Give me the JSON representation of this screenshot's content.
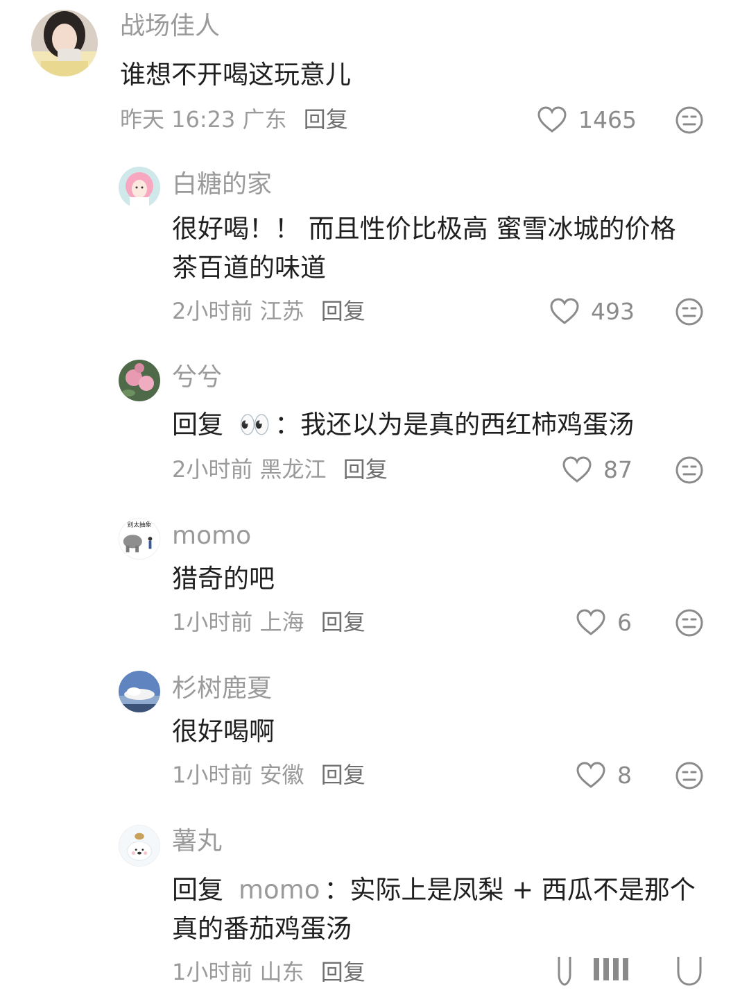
{
  "comments": [
    {
      "username": "战场佳人",
      "text": "谁想不开喝这玩意儿",
      "time": "昨天 16:23",
      "location": "广东",
      "reply_label": "回复",
      "likes": "1465"
    },
    {
      "username": "白糖的家",
      "text": "很好喝！！ 而且性价比极高 蜜雪冰城的价格 茶百道的味道",
      "time": "2小时前",
      "location": "江苏",
      "reply_label": "回复",
      "likes": "493"
    },
    {
      "username": "兮兮",
      "reply_prefix": "回复",
      "reply_target": "👀",
      "text": "：我还以为是真的西红柿鸡蛋汤",
      "time": "2小时前",
      "location": "黑龙江",
      "reply_label": "回复",
      "likes": "87"
    },
    {
      "username": "momo",
      "avatar_text": "别太抽象",
      "text": "猎奇的吧",
      "time": "1小时前",
      "location": "上海",
      "reply_label": "回复",
      "likes": "6"
    },
    {
      "username": "杉树鹿夏",
      "text": "很好喝啊",
      "time": "1小时前",
      "location": "安徽",
      "reply_label": "回复",
      "likes": "8"
    },
    {
      "username": "薯丸",
      "reply_prefix": "回复",
      "reply_target": "momo",
      "text": "：实际上是凤梨 + 西瓜不是那个真的番茄鸡蛋汤",
      "time": "1小时前",
      "location": "山东",
      "reply_label": "回复"
    }
  ],
  "colors": {
    "background": "#ffffff",
    "text_primary": "#1f1f1f",
    "text_secondary": "#9a9a9a",
    "icon": "#8a8a8a"
  },
  "icons": {
    "like": "heart-outline-icon",
    "dislike": "unhappy-face-icon"
  }
}
